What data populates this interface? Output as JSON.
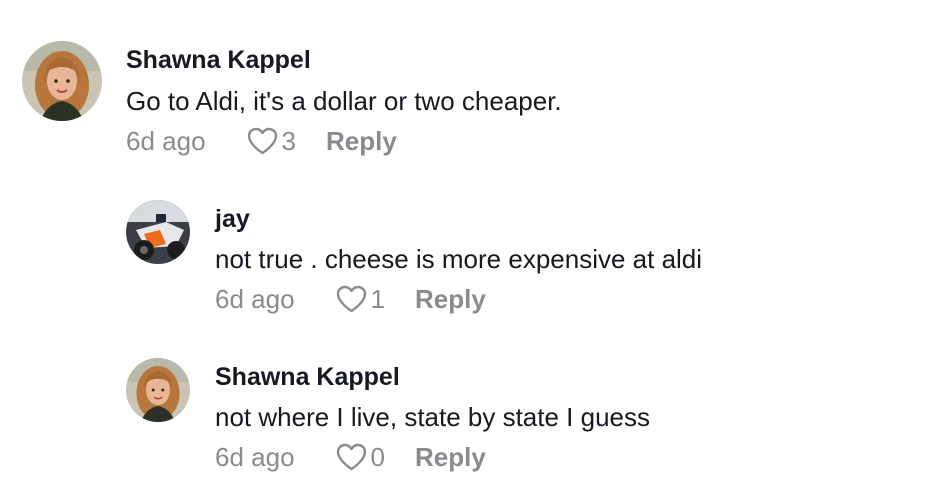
{
  "comments": [
    {
      "username": "Shawna Kappel",
      "text": "Go to Aldi, it's a dollar or two cheaper.",
      "time": "6d ago",
      "likes": "3",
      "reply_label": "Reply",
      "avatar": "woman-portrait"
    },
    {
      "username": "jay",
      "text": "not true . cheese is more expensive at aldi",
      "time": "6d ago",
      "likes": "1",
      "reply_label": "Reply",
      "avatar": "motorcycle-photo"
    },
    {
      "username": "Shawna Kappel",
      "text": "not where I live, state by state I guess",
      "time": "6d ago",
      "likes": "0",
      "reply_label": "Reply",
      "avatar": "woman-portrait"
    }
  ],
  "colors": {
    "text": "#161823",
    "secondary": "#8a8b91"
  }
}
